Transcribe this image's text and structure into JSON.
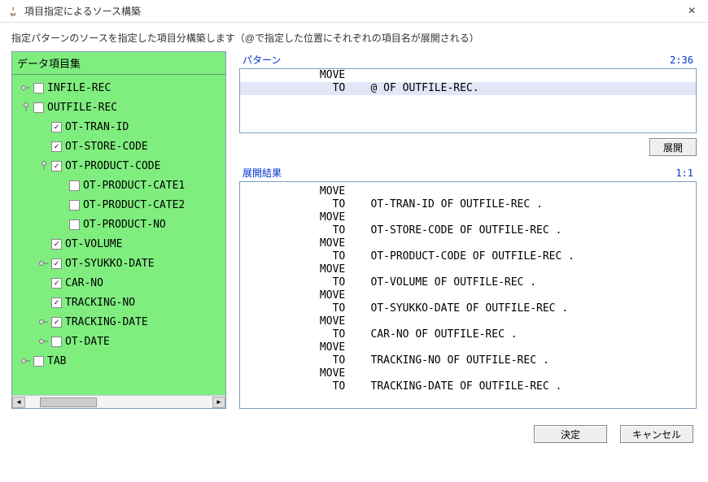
{
  "window": {
    "title": "項目指定によるソース構築",
    "close_glyph": "×"
  },
  "description": "指定パターンのソースを指定した項目分構築します（@で指定した位置にそれぞれの項目名が展開される）",
  "tree_header": "データ項目集",
  "tree": [
    {
      "indent": 0,
      "toggle": "▸",
      "checked": false,
      "label": "INFILE-REC"
    },
    {
      "indent": 0,
      "toggle": "▾",
      "checked": false,
      "label": "OUTFILE-REC"
    },
    {
      "indent": 1,
      "toggle": "",
      "checked": true,
      "label": "OT-TRAN-ID"
    },
    {
      "indent": 1,
      "toggle": "",
      "checked": true,
      "label": "OT-STORE-CODE"
    },
    {
      "indent": 1,
      "toggle": "▾",
      "checked": true,
      "label": "OT-PRODUCT-CODE"
    },
    {
      "indent": 2,
      "toggle": "",
      "checked": false,
      "label": "OT-PRODUCT-CATE1"
    },
    {
      "indent": 2,
      "toggle": "",
      "checked": false,
      "label": "OT-PRODUCT-CATE2"
    },
    {
      "indent": 2,
      "toggle": "",
      "checked": false,
      "label": "OT-PRODUCT-NO"
    },
    {
      "indent": 1,
      "toggle": "",
      "checked": true,
      "label": "OT-VOLUME"
    },
    {
      "indent": 1,
      "toggle": "▸",
      "checked": true,
      "label": "OT-SYUKKO-DATE"
    },
    {
      "indent": 1,
      "toggle": "",
      "checked": true,
      "label": "CAR-NO"
    },
    {
      "indent": 1,
      "toggle": "",
      "checked": true,
      "label": "TRACKING-NO"
    },
    {
      "indent": 1,
      "toggle": "▸",
      "checked": true,
      "label": "TRACKING-DATE"
    },
    {
      "indent": 1,
      "toggle": "▸",
      "checked": false,
      "label": "OT-DATE"
    },
    {
      "indent": 0,
      "toggle": "▸",
      "checked": false,
      "label": "TAB"
    }
  ],
  "pattern": {
    "title": "パターン",
    "pos": "2:36",
    "lines": [
      "            MOVE",
      "              TO    @ OF OUTFILE-REC."
    ],
    "highlight_index": 1
  },
  "expand_button": "展開",
  "result": {
    "title": "展開結果",
    "pos": "1:1",
    "lines": [
      "            MOVE",
      "              TO    OT-TRAN-ID OF OUTFILE-REC .",
      "            MOVE",
      "              TO    OT-STORE-CODE OF OUTFILE-REC .",
      "            MOVE",
      "              TO    OT-PRODUCT-CODE OF OUTFILE-REC .",
      "            MOVE",
      "              TO    OT-VOLUME OF OUTFILE-REC .",
      "            MOVE",
      "              TO    OT-SYUKKO-DATE OF OUTFILE-REC .",
      "            MOVE",
      "              TO    CAR-NO OF OUTFILE-REC .",
      "            MOVE",
      "              TO    TRACKING-NO OF OUTFILE-REC .",
      "            MOVE",
      "              TO    TRACKING-DATE OF OUTFILE-REC ."
    ]
  },
  "buttons": {
    "ok": "決定",
    "cancel": "キャンセル"
  }
}
